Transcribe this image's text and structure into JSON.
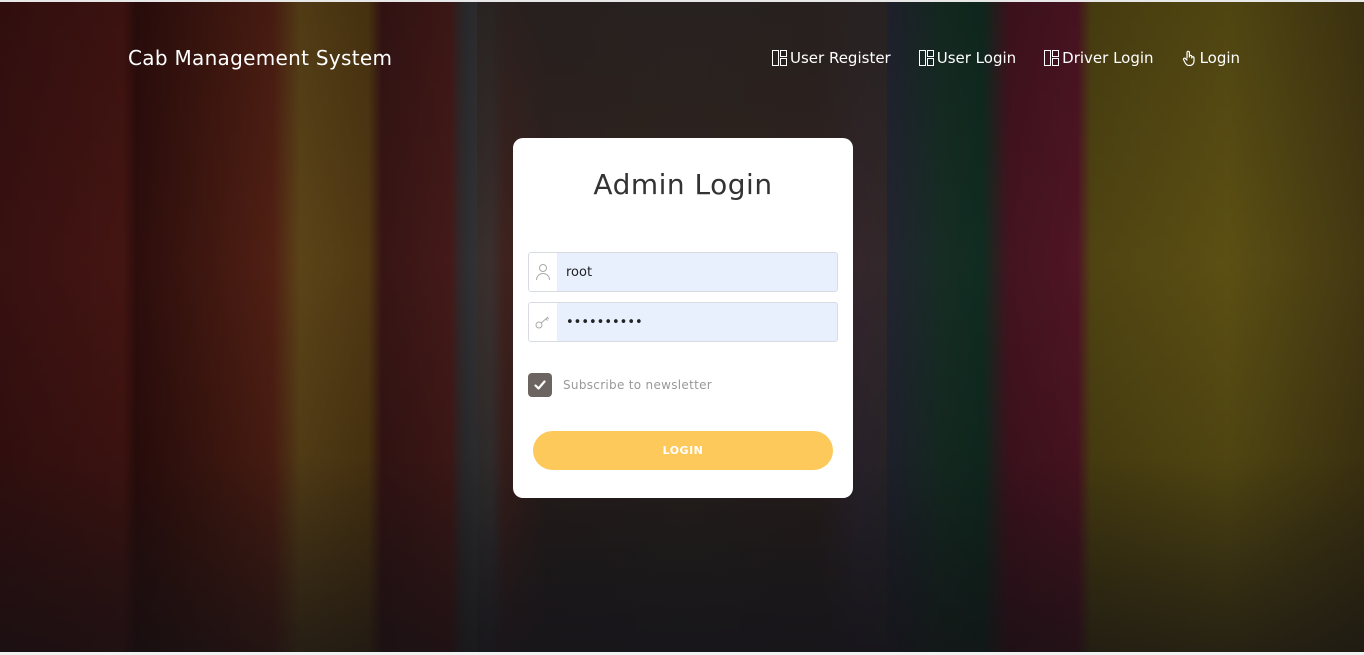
{
  "header": {
    "brand": "Cab Management System",
    "nav": [
      {
        "label": "User Register",
        "icon": "grid-icon"
      },
      {
        "label": "User Login",
        "icon": "grid-icon"
      },
      {
        "label": "Driver Login",
        "icon": "grid-icon"
      },
      {
        "label": "Login",
        "icon": "hand-pointer-icon"
      }
    ]
  },
  "login_card": {
    "title": "Admin Login",
    "username": {
      "value": "root",
      "icon": "user-icon"
    },
    "password": {
      "value": "••••••••••",
      "icon": "key-icon"
    },
    "newsletter": {
      "label": "Subscribe to newsletter",
      "checked": true
    },
    "submit_label": "LOGIN"
  },
  "colors": {
    "button": "#fcc95a",
    "checkbox": "#6b6460",
    "input_bg": "#e8f0fe"
  }
}
